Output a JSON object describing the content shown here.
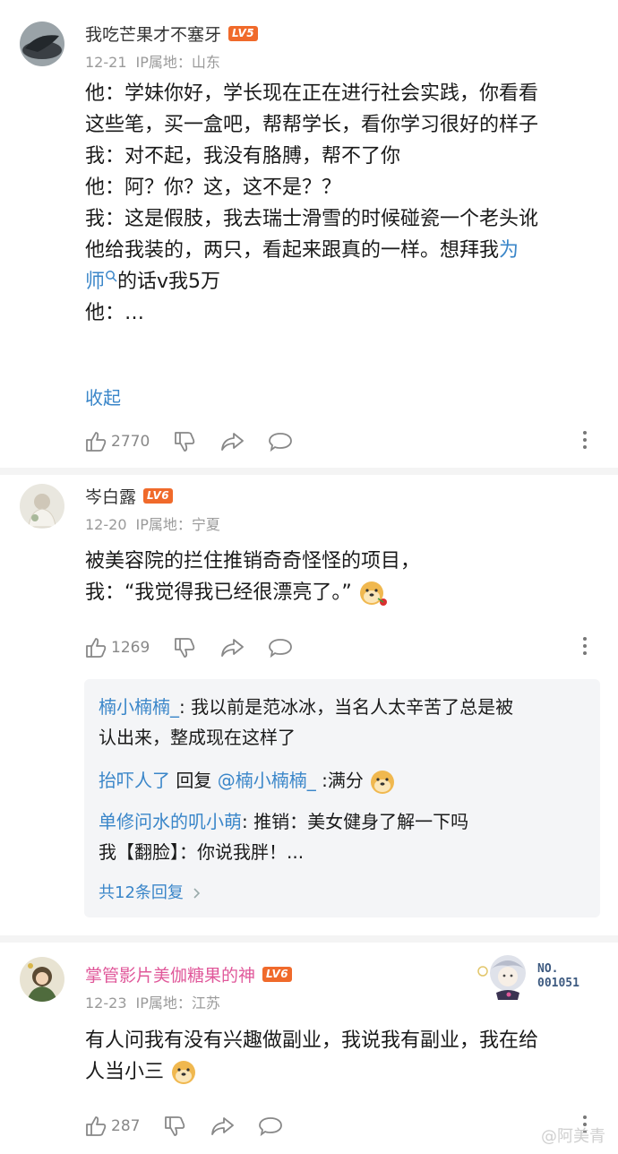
{
  "comments": [
    {
      "username": "我吃芒果才不塞牙",
      "level": "LV5",
      "date": "12-21",
      "ip": "IP属地：山东",
      "lines": [
        "他：学妹你好，学长现在正在进行社会实践，你看看",
        "这些笔，买一盒吧，帮帮学长，看你学习很好的样子",
        "我：对不起，我没有胳膊，帮不了你",
        "他：阿？你？这，这不是？？",
        "我：这是假肢，我去瑞士滑雪的时候碰瓷一个老头讹",
        "他给我装的，两只，看起来跟真的一样。想拜我",
        "他：…"
      ],
      "link_text_1": "为",
      "link_text_2": "师",
      "after_link": "的话v我5万",
      "collapse": "收起",
      "likes": "2770"
    },
    {
      "username": "岑白露",
      "level": "LV6",
      "date": "12-20",
      "ip": "IP属地：宁夏",
      "lines": [
        "被美容院的拦住推销奇奇怪怪的项目，",
        "我：“我觉得我已经很漂亮了。”"
      ],
      "likes": "1269"
    },
    {
      "username": "掌管影片美伽糖果的神",
      "level": "LV6",
      "date": "12-23",
      "ip": "IP属地：江苏",
      "lines": [
        "有人问我有没有兴趣做副业，我说我有副业，我在给",
        "人当小三"
      ],
      "likes": "287",
      "badge_label": "NO.",
      "badge_number": "001051"
    }
  ],
  "replies": {
    "r1_name": "楠小楠楠_",
    "r1_text_a": ": 我以前是范冰冰，当名人太辛苦了总是被",
    "r1_text_b": "认出来，整成现在这样了",
    "r2_name": "抬吓人了",
    "r2_mid": " 回复 ",
    "r2_target": "@楠小楠楠_",
    "r2_text": " :满分",
    "r3_name": "单修问水的叽小萌",
    "r3_text_a": ": 推销：美女健身了解一下吗",
    "r3_text_b": "我【翻脸】：你说我胖！...",
    "total": "共12条回复"
  },
  "watermark": "@阿美青",
  "colors": {
    "link": "#3a86c9",
    "level_badge": "#f06a2b",
    "pink_name": "#e0589a"
  }
}
